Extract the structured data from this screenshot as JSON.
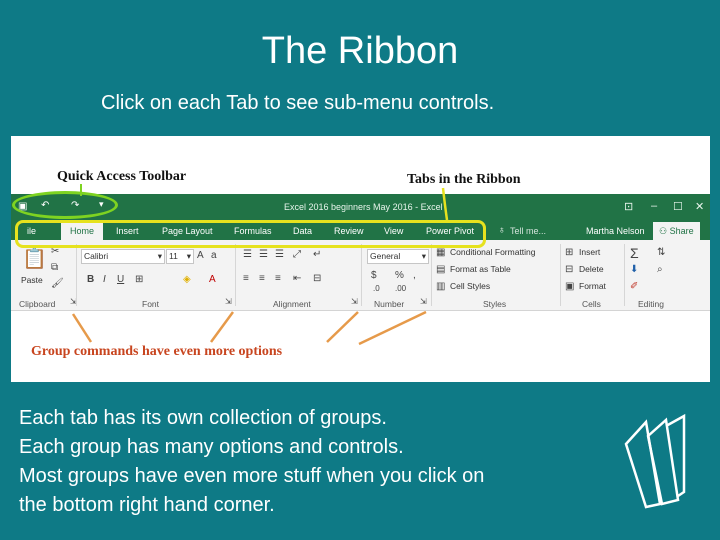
{
  "slide": {
    "title": "The Ribbon",
    "subtitle": "Click on each Tab to see sub-menu controls.",
    "body_lines": [
      "Each tab has its own collection of groups.",
      "Each group has many options and controls.",
      "Most groups have even more stuff when you click on",
      "the bottom right hand corner."
    ]
  },
  "annotations": {
    "qat": "Quick Access Toolbar",
    "tabs": "Tabs in the Ribbon",
    "groups": "Group commands have even more options"
  },
  "excel": {
    "window_title": "Excel 2016 beginners May 2016 - Excel",
    "tabs": [
      "ile",
      "Home",
      "Insert",
      "Page Layout",
      "Formulas",
      "Data",
      "Review",
      "View",
      "Power Pivot"
    ],
    "tell_me": "Tell me...",
    "user": "Martha Nelson",
    "share": "Share",
    "font_name": "Calibri",
    "font_size": "11",
    "number_format": "General",
    "paste_label": "Paste",
    "styles": [
      "Conditional Formatting",
      "Format as Table",
      "Cell Styles"
    ],
    "cells": [
      "Insert",
      "Delete",
      "Format"
    ],
    "groups": [
      "Clipboard",
      "Font",
      "Alignment",
      "Number",
      "Styles",
      "Cells",
      "Editing"
    ]
  },
  "colors": {
    "background": "#0e7a86",
    "excel_green": "#217346",
    "annotation_orange": "#c8451f",
    "highlight_yellow": "#e6e21e",
    "highlight_green": "#7ed321"
  }
}
